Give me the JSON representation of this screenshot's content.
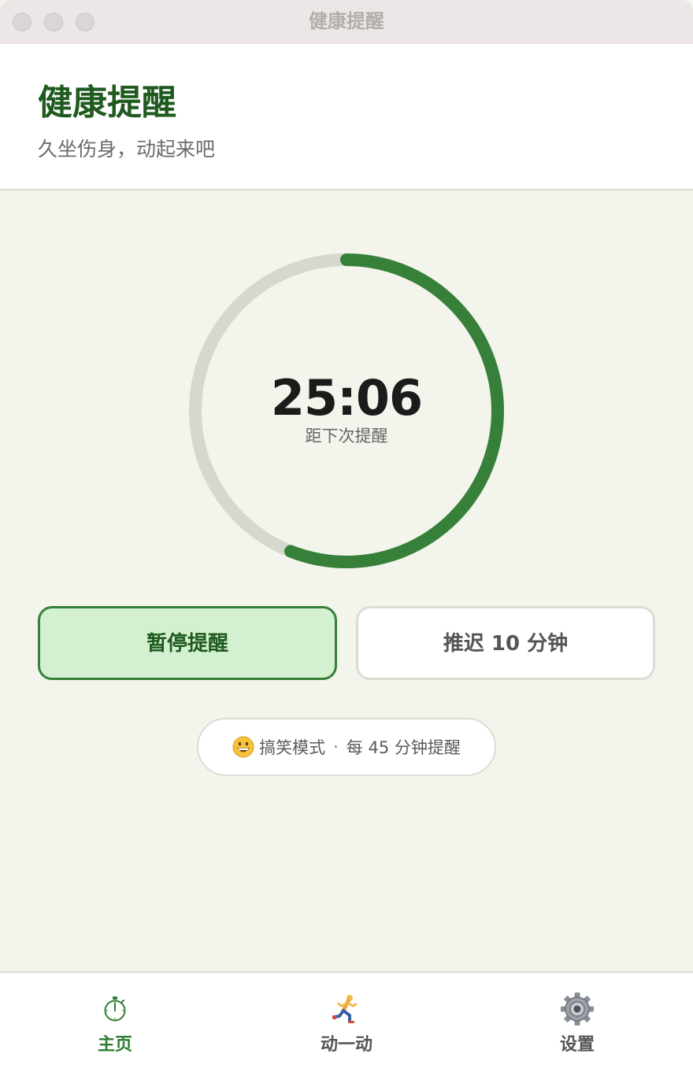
{
  "window": {
    "title": "健康提醒"
  },
  "header": {
    "title": "健康提醒",
    "subtitle": "久坐伤身，动起来吧"
  },
  "timer": {
    "remaining": "25:06",
    "caption": "距下次提醒",
    "progress_fraction": 0.56,
    "colors": {
      "progress": "#37803a",
      "track": "#d5d8cf"
    }
  },
  "actions": {
    "pause_label": "暂停提醒",
    "snooze_label": "推迟 10 分钟"
  },
  "mode": {
    "icon": "grinning-face-emoji",
    "name": "搞笑模式",
    "separator": "·",
    "interval_text": "每 45 分钟提醒"
  },
  "tabs": [
    {
      "label": "主页",
      "icon": "stopwatch-icon",
      "active": true
    },
    {
      "label": "动一动",
      "icon": "running-person-icon",
      "active": false
    },
    {
      "label": "设置",
      "icon": "gear-icon",
      "active": false
    }
  ],
  "colors": {
    "accent": "#2e7d32",
    "title_green": "#1f5a1f",
    "background": "#f3f4ec"
  }
}
